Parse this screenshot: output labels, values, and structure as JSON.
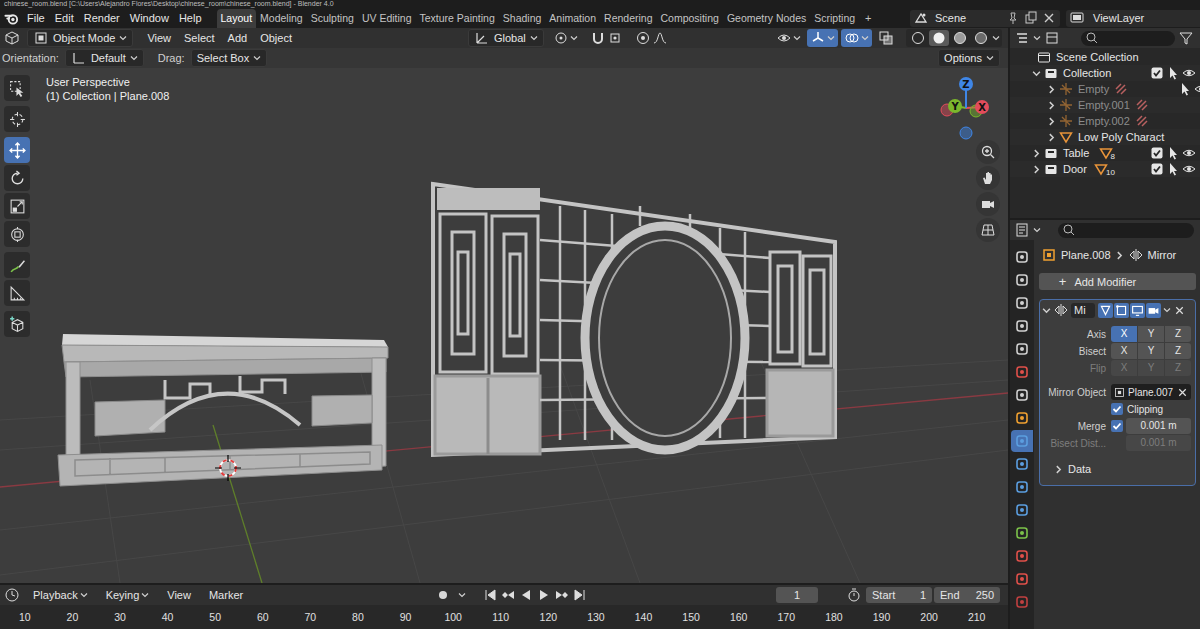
{
  "window": {
    "title": "chinese_room.blend [C:\\Users\\Alejandro Flores\\Desktop\\chinese_room\\chinese_room.blend] - Blender 4.0"
  },
  "topbar": {
    "menus": [
      "File",
      "Edit",
      "Render",
      "Window",
      "Help"
    ],
    "workspaces": [
      {
        "label": "Layout",
        "selected": true
      },
      {
        "label": "Modeling",
        "selected": false
      },
      {
        "label": "Sculpting",
        "selected": false
      },
      {
        "label": "UV Editing",
        "selected": false
      },
      {
        "label": "Texture Painting",
        "selected": false
      },
      {
        "label": "Shading",
        "selected": false
      },
      {
        "label": "Animation",
        "selected": false
      },
      {
        "label": "Rendering",
        "selected": false
      },
      {
        "label": "Compositing",
        "selected": false
      },
      {
        "label": "Geometry Nodes",
        "selected": false
      },
      {
        "label": "Scripting",
        "selected": false
      }
    ],
    "add_workspace": "+",
    "scene": "Scene",
    "view_layer": "ViewLayer"
  },
  "viewport_header": {
    "mode": "Object Mode",
    "menus": [
      "View",
      "Select",
      "Add",
      "Object"
    ],
    "orientation": "Global",
    "snap": {
      "selected": false
    },
    "proportional": {
      "selected": false
    },
    "overlay_buttons": [
      {
        "kind": "visibility",
        "selected": false
      },
      {
        "kind": "gizmos",
        "selected": true
      },
      {
        "kind": "overlays",
        "selected": true
      },
      {
        "kind": "xray",
        "selected": false
      }
    ],
    "shading": [
      {
        "kind": "wireframe",
        "selected": false
      },
      {
        "kind": "solid",
        "selected": true
      },
      {
        "kind": "material",
        "selected": false
      },
      {
        "kind": "rendered",
        "selected": false
      }
    ]
  },
  "tool_settings": {
    "orientation_label": "Orientation:",
    "orientation": "Default",
    "drag_label": "Drag:",
    "drag": "Select Box",
    "options": "Options"
  },
  "toolbar": [
    {
      "kind": "select",
      "selected": false
    },
    {
      "kind": "cursor",
      "selected": false
    },
    {
      "kind": "move",
      "selected": true
    },
    {
      "kind": "rotate",
      "selected": false
    },
    {
      "kind": "scale",
      "selected": false
    },
    {
      "kind": "transform",
      "selected": false
    },
    {
      "kind": "annotate",
      "selected": false
    },
    {
      "kind": "measure",
      "selected": false
    },
    {
      "kind": "add",
      "selected": false
    }
  ],
  "viewport": {
    "view_name": "User Perspective",
    "context": "(1) Collection | Plane.008",
    "axes": [
      {
        "label": "X",
        "color": "#e34c5b"
      },
      {
        "label": "Y",
        "color": "#7bb72c"
      },
      {
        "label": "Z",
        "color": "#3f86e6"
      }
    ]
  },
  "outliner": {
    "rows": [
      {
        "name": "Scene Collection",
        "kind": "scene",
        "depth": 0,
        "dimmed": false,
        "toggles": false
      },
      {
        "name": "Collection",
        "kind": "collection",
        "depth": 1,
        "expanded": true,
        "dimmed": false,
        "toggles": true,
        "checked": true
      },
      {
        "name": "Empty",
        "kind": "empty",
        "depth": 2,
        "expanded": false,
        "dimmed": true,
        "toggles": true
      },
      {
        "name": "Empty.001",
        "kind": "empty",
        "depth": 2,
        "expanded": false,
        "dimmed": true,
        "toggles": true
      },
      {
        "name": "Empty.002",
        "kind": "empty",
        "depth": 2,
        "expanded": false,
        "dimmed": true,
        "toggles": true
      },
      {
        "name": "Low Poly Charact",
        "kind": "mesh",
        "depth": 2,
        "expanded": false,
        "dimmed": false,
        "toggles": false
      },
      {
        "name": "Table",
        "kind": "collection",
        "depth": 1,
        "expanded": false,
        "dimmed": false,
        "toggles": true,
        "checked": true,
        "badge": "8"
      },
      {
        "name": "Door",
        "kind": "collection",
        "depth": 1,
        "expanded": false,
        "dimmed": false,
        "toggles": true,
        "checked": true,
        "badge": "10"
      }
    ]
  },
  "properties": {
    "tabs": [
      {
        "color": "#d0d0d0",
        "selected": false
      },
      {
        "color": "#d0d0d0",
        "selected": false
      },
      {
        "color": "#d0d0d0",
        "selected": false
      },
      {
        "color": "#d0d0d0",
        "selected": false
      },
      {
        "color": "#d0d0d0",
        "selected": false
      },
      {
        "color": "#e0504a",
        "selected": false
      },
      {
        "color": "#d0d0d0",
        "selected": false
      },
      {
        "color": "#f0a030",
        "selected": false
      },
      {
        "color": "#5b9ee0",
        "selected": true
      },
      {
        "color": "#5b9ee0",
        "selected": false
      },
      {
        "color": "#5b9ee0",
        "selected": false
      },
      {
        "color": "#5b9ee0",
        "selected": false
      },
      {
        "color": "#7cc24a",
        "selected": false
      },
      {
        "color": "#e0504a",
        "selected": false
      },
      {
        "color": "#e0504a",
        "selected": false
      },
      {
        "color": "#c04040",
        "selected": false
      }
    ],
    "breadcrumb": {
      "object": "Plane.008",
      "modifier": "Mirror"
    },
    "add_modifier": {
      "icon": "+",
      "label": "Add Modifier"
    },
    "modifier": {
      "name": "Mi",
      "expanded": true,
      "toggles": [
        {
          "kind": "on_cage",
          "selected": true
        },
        {
          "kind": "edit_mode",
          "selected": true
        },
        {
          "kind": "viewport",
          "selected": true
        },
        {
          "kind": "render",
          "selected": true
        }
      ],
      "rows": [
        {
          "kind": "toggles",
          "label": "Axis",
          "disabled": false,
          "options": [
            {
              "label": "X",
              "selected": true
            },
            {
              "label": "Y",
              "selected": false
            },
            {
              "label": "Z",
              "selected": false
            }
          ]
        },
        {
          "kind": "toggles",
          "label": "Bisect",
          "disabled": false,
          "options": [
            {
              "label": "X",
              "selected": false
            },
            {
              "label": "Y",
              "selected": false
            },
            {
              "label": "Z",
              "selected": false
            }
          ]
        },
        {
          "kind": "toggles",
          "label": "Flip",
          "disabled": true,
          "options": [
            {
              "label": "X",
              "selected": false
            },
            {
              "label": "Y",
              "selected": false
            },
            {
              "label": "Z",
              "selected": false
            }
          ]
        },
        {
          "kind": "object",
          "label": "Mirror Object",
          "disabled": false,
          "value": "Plane.007"
        },
        {
          "kind": "check",
          "label": "Clipping",
          "disabled": false,
          "checked": true
        },
        {
          "kind": "check_number",
          "label": "Merge",
          "disabled": false,
          "checked": true,
          "value": "0.001 m"
        },
        {
          "kind": "number",
          "label": "Bisect Dist...",
          "disabled": true,
          "value": "0.001 m"
        },
        {
          "kind": "subpanel",
          "label": "Data",
          "disabled": false,
          "expanded": false
        }
      ]
    }
  },
  "timeline": {
    "menus": [
      "Playback",
      "Keying",
      "View",
      "Marker"
    ],
    "auto_key": false,
    "current_frame": "1",
    "start_label": "Start",
    "start": "1",
    "end_label": "End",
    "end": "250",
    "ticks": [
      "10",
      "20",
      "30",
      "40",
      "50",
      "60",
      "70",
      "80",
      "90",
      "100",
      "110",
      "120",
      "130",
      "140",
      "150",
      "160",
      "170",
      "180",
      "190",
      "200",
      "210"
    ]
  }
}
